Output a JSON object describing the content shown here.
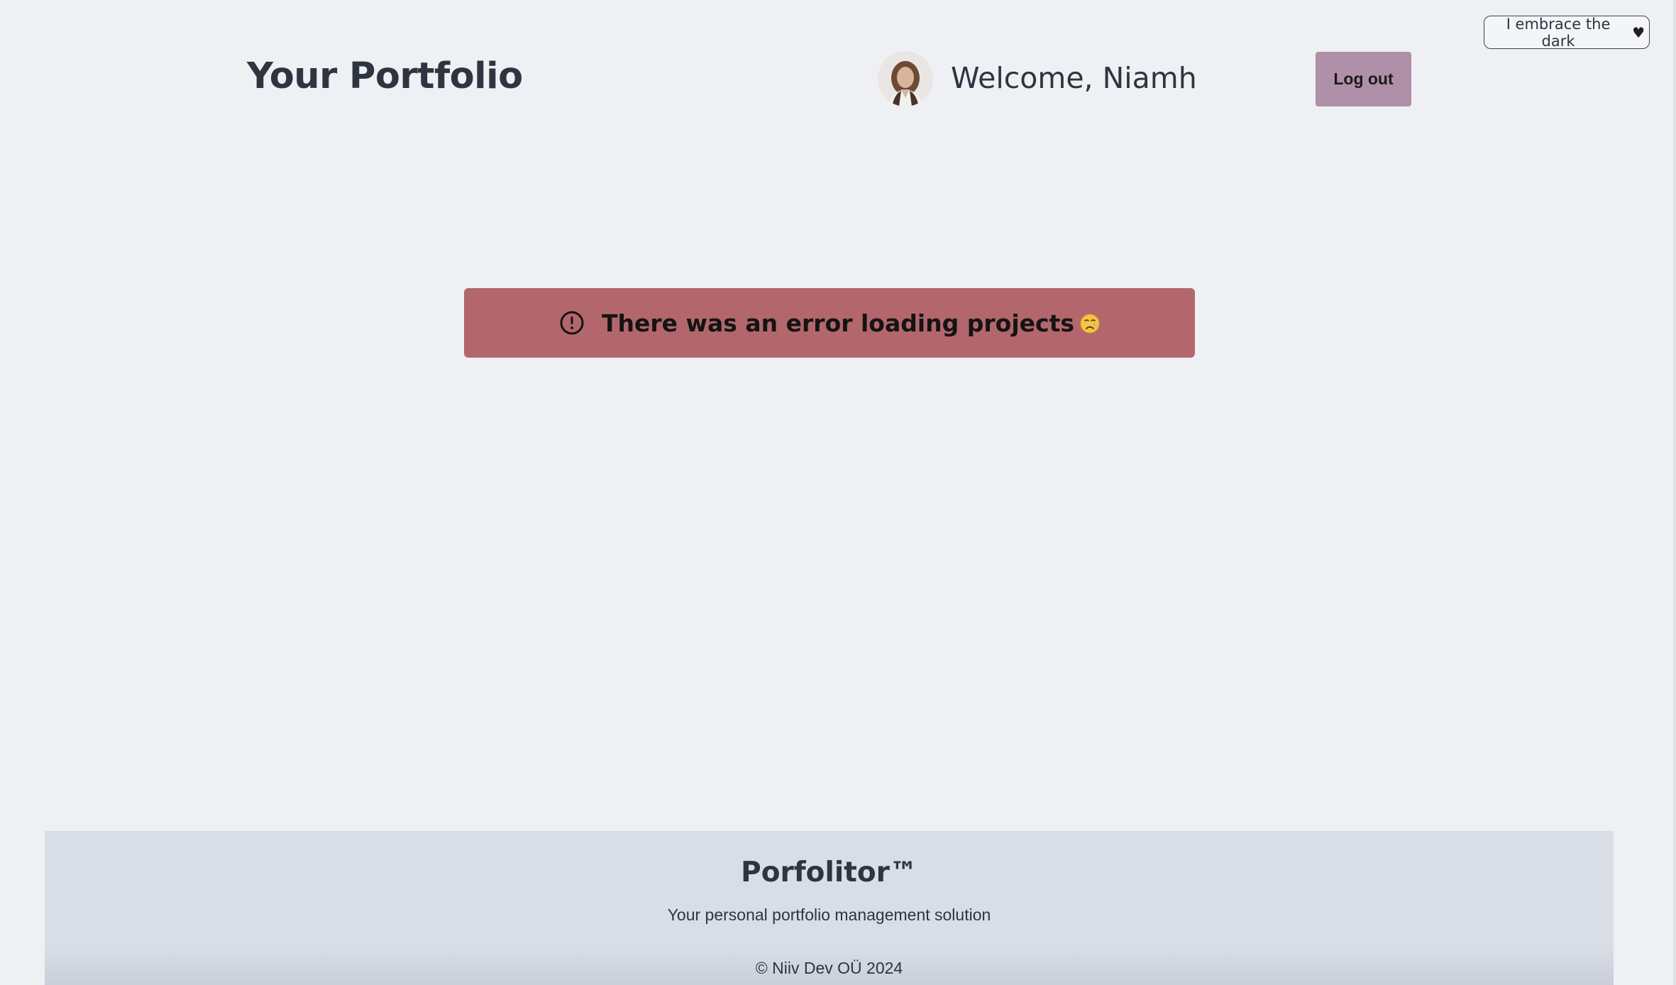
{
  "theme_toggle": {
    "label": "I embrace the dark",
    "icon": "black-heart-icon"
  },
  "header": {
    "title": "Your Portfolio",
    "welcome": "Welcome, Niamh",
    "logout_label": "Log out"
  },
  "error": {
    "message": "There was an error loading projects",
    "icon": "alert-circle-icon",
    "emoji": "crying-face-icon"
  },
  "footer": {
    "brand": "Porfolitor™",
    "tagline": "Your personal portfolio management solution",
    "copyright": "© Niiv Dev OÜ 2024"
  },
  "colors": {
    "background": "#eff0f4",
    "error_banner": "#b3676c",
    "logout_button": "#b08fa8",
    "footer": "#d9dde6",
    "text": "#2e3440"
  }
}
